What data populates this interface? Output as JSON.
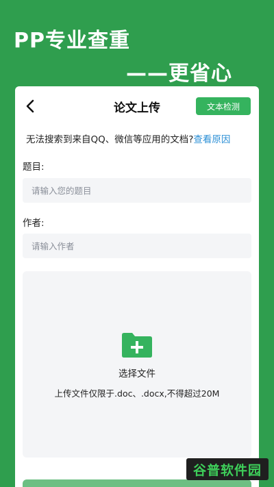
{
  "promo": {
    "title": "PP专业查重",
    "subtitle": "——更省心"
  },
  "header": {
    "back_icon": "chevron-left-icon",
    "title": "论文上传",
    "check_button": "文本检测"
  },
  "notice": {
    "text": "无法搜索到来自QQ、微信等应用的文档?",
    "link": "查看原因"
  },
  "form": {
    "title_label": "题目:",
    "title_placeholder": "请输入您的题目",
    "title_value": "",
    "author_label": "作者:",
    "author_placeholder": "请输入作者",
    "author_value": ""
  },
  "upload": {
    "icon": "folder-add-icon",
    "label": "选择文件",
    "hint": "上传文件仅限于.doc、.docx,不得超过20M"
  },
  "watermark": {
    "text": "谷普软件园"
  },
  "colors": {
    "background": "#2f9e4e",
    "accent": "#35b35e",
    "link": "#2b8fd6",
    "input_bg": "#f4f5f7"
  }
}
